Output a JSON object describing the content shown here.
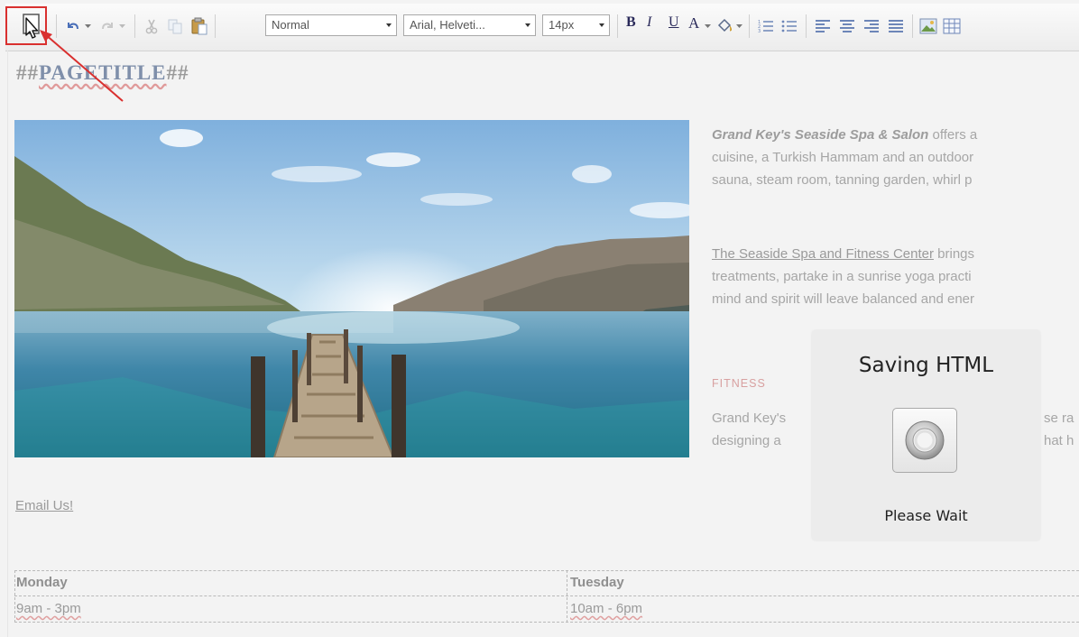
{
  "toolbar": {
    "save_tooltip": "Save",
    "style_combo": "Normal",
    "font_combo": "Arial, Helveti...",
    "size_combo": "14px",
    "bold": "B",
    "italic": "I",
    "underline": "U",
    "font_color": "A"
  },
  "editor": {
    "page_title": "##PAGETITLE##",
    "page_title_prefix": "##",
    "page_title_word": "PAGETITLE",
    "page_title_suffix": "##",
    "intro_bold": "Grand Key's Seaside Spa & Salon",
    "intro_rest": " offers a",
    "intro_line2": "cuisine, a Turkish Hammam and an outdoor",
    "intro_line3": "sauna, steam room, tanning garden, whirl p",
    "spa_link": "The Seaside Spa and Fitness Center",
    "spa_rest": " brings",
    "spa_line2": "treatments, partake in a sunrise yoga practi",
    "spa_line3": "mind and spirit will leave balanced and ener",
    "fitness_heading": "FITNESS",
    "fitness_line1_a": "Grand Key's",
    "fitness_line1_b": "se ra",
    "fitness_line2_a": "designing a",
    "fitness_line2_b": "hat h",
    "email_link": "Email Us!",
    "schedule": [
      {
        "day": "Monday",
        "hours": "9am - 3pm"
      },
      {
        "day": "Tuesday",
        "hours": "10am - 6pm"
      }
    ]
  },
  "dialog": {
    "title": "Saving HTML",
    "message": "Please Wait"
  },
  "colors": {
    "highlight_red": "#d9302f",
    "fitness_heading": "#d8a0a0"
  }
}
